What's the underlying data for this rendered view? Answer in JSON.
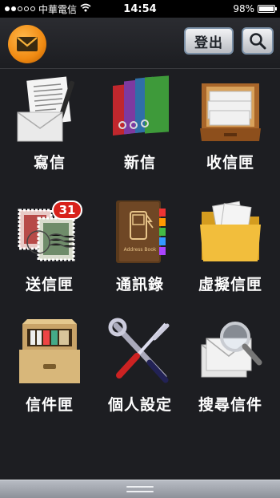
{
  "status_bar": {
    "carrier": "中華電信",
    "time": "14:54",
    "battery": "98%",
    "battery_level": 0.98,
    "signal_bars_filled": 2,
    "signal_bars_total": 5
  },
  "header": {
    "logout_label": "登出"
  },
  "menu": [
    {
      "label": "寫信",
      "icon": "write-letter-icon"
    },
    {
      "label": "新信",
      "icon": "new-mail-folders-icon"
    },
    {
      "label": "收信匣",
      "icon": "inbox-tray-icon"
    },
    {
      "label": "送信匣",
      "icon": "sent-stamps-icon",
      "badge": "31"
    },
    {
      "label": "通訊錄",
      "icon": "address-book-icon",
      "book_text": "Address Book"
    },
    {
      "label": "虛擬信匣",
      "icon": "virtual-folder-icon"
    },
    {
      "label": "信件匣",
      "icon": "filing-drawer-icon"
    },
    {
      "label": "個人設定",
      "icon": "settings-tools-icon"
    },
    {
      "label": "搜尋信件",
      "icon": "search-mail-icon"
    }
  ],
  "colors": {
    "background": "#1d1e22",
    "accent_orange": "#f08a12",
    "badge_red": "#d8221b"
  }
}
